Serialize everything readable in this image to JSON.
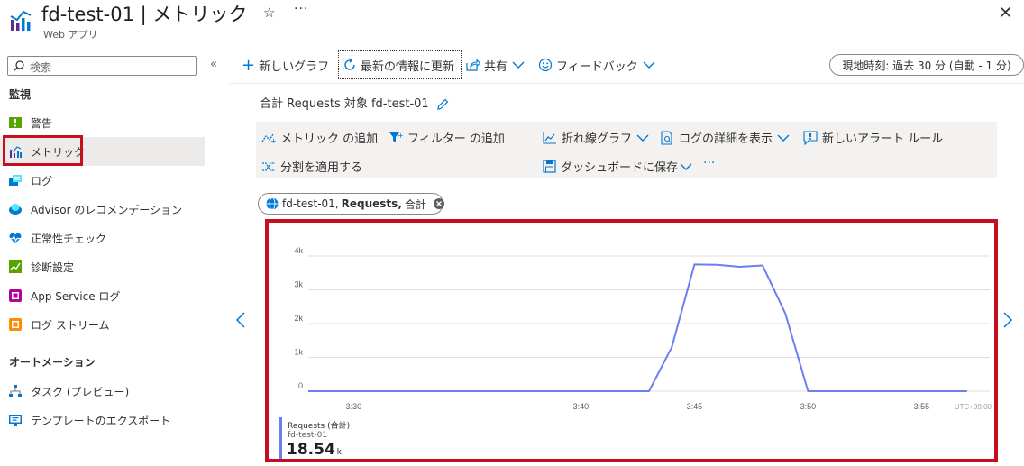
{
  "header": {
    "title": "fd-test-01 | メトリック",
    "subtitle": "Web アプリ",
    "favorite_icon": "☆",
    "more_icon": "···",
    "close_icon": "✕"
  },
  "sidebar": {
    "search_placeholder": "検索",
    "collapse_icon": "«",
    "sections": [
      {
        "title": "監視",
        "items": [
          {
            "label": "警告",
            "icon": "alert-icon",
            "active": false
          },
          {
            "label": "メトリック",
            "icon": "metrics-icon",
            "active": true
          },
          {
            "label": "ログ",
            "icon": "logs-icon",
            "active": false
          },
          {
            "label": "Advisor のレコメンデーション",
            "icon": "advisor-icon",
            "active": false
          },
          {
            "label": "正常性チェック",
            "icon": "health-icon",
            "active": false
          },
          {
            "label": "診断設定",
            "icon": "diagnostic-icon",
            "active": false
          },
          {
            "label": "App Service ログ",
            "icon": "app-service-logs-icon",
            "active": false
          },
          {
            "label": "ログ ストリーム",
            "icon": "log-stream-icon",
            "active": false
          }
        ]
      },
      {
        "title": "オートメーション",
        "items": [
          {
            "label": "タスク (プレビュー)",
            "icon": "tasks-icon",
            "active": false
          },
          {
            "label": "テンプレートのエクスポート",
            "icon": "export-template-icon",
            "active": false
          }
        ]
      }
    ]
  },
  "toolbar": {
    "new_chart": "新しいグラフ",
    "refresh": "最新の情報に更新",
    "share": "共有",
    "feedback": "フィードバック",
    "time_range": "現地時刻: 過去 30 分 (自動 - 1 分)"
  },
  "chart_title": "合計 Requests 対象 fd-test-01",
  "chart_toolbar": {
    "add_metric": "メトリック の追加",
    "add_filter": "フィルター の追加",
    "line_chart": "折れ線グラフ",
    "view_logs": "ログの詳細を表示",
    "new_alert": "新しいアラート ルール",
    "apply_split": "分割を適用する",
    "save_dashboard": "ダッシュボードに保存",
    "more": "···"
  },
  "metric_pill": {
    "resource": "fd-test-01,",
    "metric": "Requests,",
    "aggregation": "合計"
  },
  "legend": {
    "name": "Requests (合計)",
    "resource": "fd-test-01",
    "value": "18.54",
    "unit": "k"
  },
  "chart_data": {
    "type": "line",
    "series": [
      {
        "name": "Requests (合計)",
        "color": "#6b7ff1",
        "points": [
          [
            "3:28",
            0
          ],
          [
            "3:43",
            0
          ],
          [
            "3:44",
            1300
          ],
          [
            "3:45",
            3750
          ],
          [
            "3:46",
            3740
          ],
          [
            "3:47",
            3680
          ],
          [
            "3:48",
            3720
          ],
          [
            "3:49",
            2300
          ],
          [
            "3:50",
            0
          ],
          [
            "3:57",
            0
          ]
        ]
      }
    ],
    "x_ticks": [
      "3:30",
      "3:40",
      "3:45",
      "3:50",
      "3:55"
    ],
    "x_timezone_label": "UTC+09:00",
    "y_ticks": [
      "4k",
      "3k",
      "2k",
      "1k",
      "0"
    ],
    "ylim": [
      0,
      4000
    ],
    "grid": true
  }
}
